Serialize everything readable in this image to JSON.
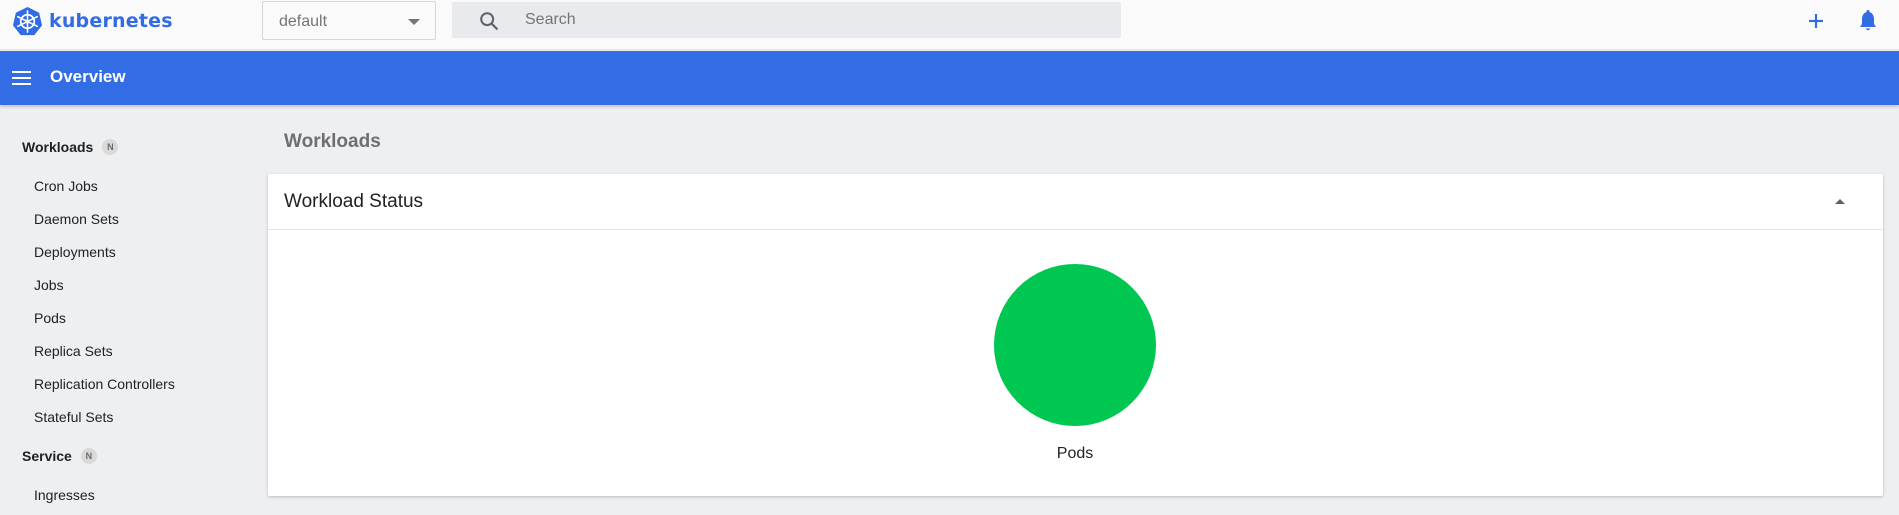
{
  "header": {
    "logo_text": "kubernetes",
    "namespace": {
      "value": "default"
    },
    "search": {
      "placeholder": "Search"
    },
    "icons": {
      "create": "plus-icon",
      "notifications": "bell-icon"
    },
    "brand_color": "#326ce5"
  },
  "titlebar": {
    "title": "Overview",
    "color": "#326de6"
  },
  "sidebar": {
    "sections": [
      {
        "label": "Workloads",
        "badge": "N"
      },
      {
        "label": "Service",
        "badge": "N"
      }
    ],
    "items": [
      "Cron Jobs",
      "Daemon Sets",
      "Deployments",
      "Jobs",
      "Pods",
      "Replica Sets",
      "Replication Controllers",
      "Stateful Sets",
      "Ingresses"
    ]
  },
  "main": {
    "heading": "Workloads",
    "card": {
      "title": "Workload Status",
      "collapse_icon": "caret-up-icon"
    }
  },
  "chart_data": {
    "type": "pie",
    "label": "Pods",
    "slices": [
      {
        "value": 1,
        "color": "#00c752"
      }
    ]
  }
}
